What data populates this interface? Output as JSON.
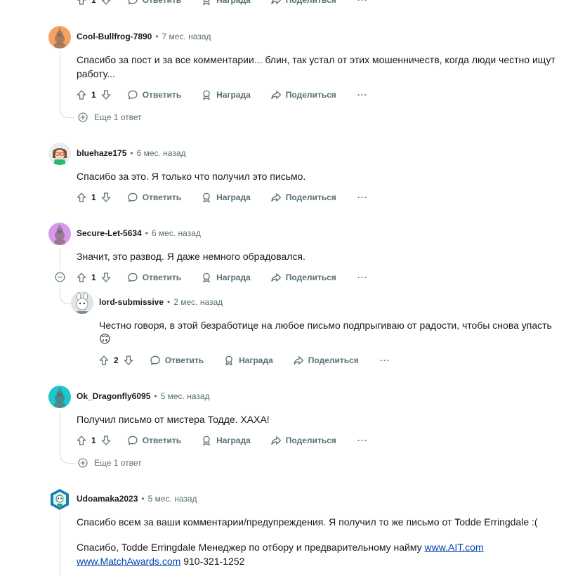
{
  "labels": {
    "reply": "Ответить",
    "award": "Награда",
    "share": "Поделиться",
    "more": "···"
  },
  "top_partial": {
    "votes": "1"
  },
  "comments": [
    {
      "user": "Cool-Bullfrog-7890",
      "time": "7 мес. назад",
      "text": "Спасибо за пост и за все комментарии... блин, так устал от этих мошенничеств, когда люди честно ищут работу...",
      "votes": "1",
      "more_replies": "Еще 1 ответ"
    },
    {
      "user": "bluehaze175",
      "time": "6 мес. назад",
      "text": "Спасибо за это. Я только что получил это письмо.",
      "votes": "1"
    },
    {
      "user": "Secure-Let-5634",
      "time": "6 мес. назад",
      "text": "Значит, это развод. Я даже немного обрадовался.",
      "votes": "1",
      "reply": {
        "user": "lord-submissive",
        "time": "2 мес. назад",
        "text": "Честно говоря, в этой безработице на любое письмо подпрыгиваю от радости, чтобы снова упасть",
        "emoji": "🙃",
        "votes": "2"
      }
    },
    {
      "user": "Ok_Dragonfly6095",
      "time": "5 мес. назад",
      "text": "Получил письмо от мистера Тодде. ХАХА!",
      "votes": "1",
      "more_replies": "Еще 1 ответ"
    },
    {
      "user": "Udoamaka2023",
      "time": "5 мес. назад",
      "text": "Спасибо всем за ваши комментарии/предупреждения. Я получил то же письмо от Todde Erringdale :(",
      "signature_text": "Спасибо, Todde Erringdale Менеджер по отбору и предварительному найму",
      "link1": "www.AIT.com",
      "link2": "www.MatchAwards.com",
      "phone": "910-321-1252"
    }
  ],
  "colors": {
    "avatar_orange": "#f4a261",
    "avatar_purple": "#d59be8",
    "avatar_teal": "#1bc8cf",
    "link": "#0045ac",
    "meta": "#576f76"
  }
}
